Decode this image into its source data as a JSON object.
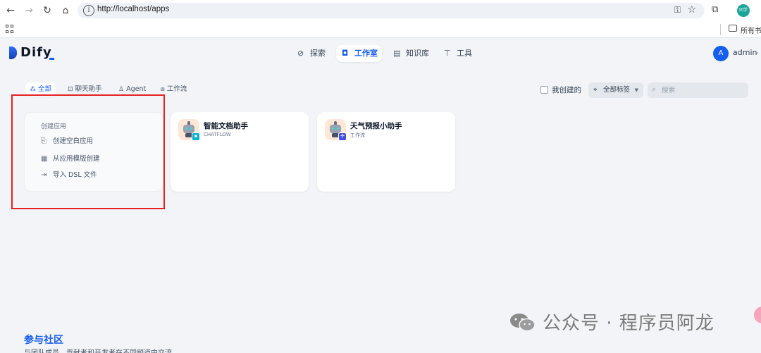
{
  "browser": {
    "url": "http://localhost/apps",
    "profile_label": "同学",
    "bookmarks_label": "所有书签"
  },
  "header": {
    "logo_text": "Dify",
    "nav": [
      {
        "icon": "explore-icon",
        "label": "探索"
      },
      {
        "icon": "robot-icon",
        "label": "工作室",
        "active": true
      },
      {
        "icon": "book-icon",
        "label": "知识库"
      },
      {
        "icon": "hammer-icon",
        "label": "工具"
      }
    ],
    "user": {
      "initial": "A",
      "name": "admin"
    }
  },
  "filters": {
    "tabs": [
      {
        "icon": "grid-icon",
        "label": "全部",
        "active": true
      },
      {
        "icon": "chat-icon",
        "label": "聊天助手"
      },
      {
        "icon": "agent-icon",
        "label": "Agent"
      },
      {
        "icon": "workflow-icon",
        "label": "工作流"
      }
    ],
    "mine_label": "我创建的",
    "mine_checked": false,
    "tags_label": "全部标签",
    "search_placeholder": "搜索"
  },
  "create_card": {
    "title": "创建应用",
    "items": [
      {
        "icon": "file-plus-icon",
        "label": "创建空白应用"
      },
      {
        "icon": "template-icon",
        "label": "从应用模版创建"
      },
      {
        "icon": "import-icon",
        "label": "导入 DSL 文件"
      }
    ]
  },
  "apps": [
    {
      "name": "智能文档助手",
      "type": "CHATFLOW",
      "badge_color": "#06aed4"
    },
    {
      "name": "天气预报小助手",
      "type": "工作流",
      "badge_color": "#444ce7"
    }
  ],
  "footer": {
    "community_title": "参与社区",
    "community_desc": "与团队成员、贡献者和开发者在不同频道中交流"
  },
  "watermark": "公众号 · 程序员阿龙",
  "colors": {
    "accent": "#155eef",
    "highlight_box": "#e62222",
    "background": "#f2f4f7"
  }
}
